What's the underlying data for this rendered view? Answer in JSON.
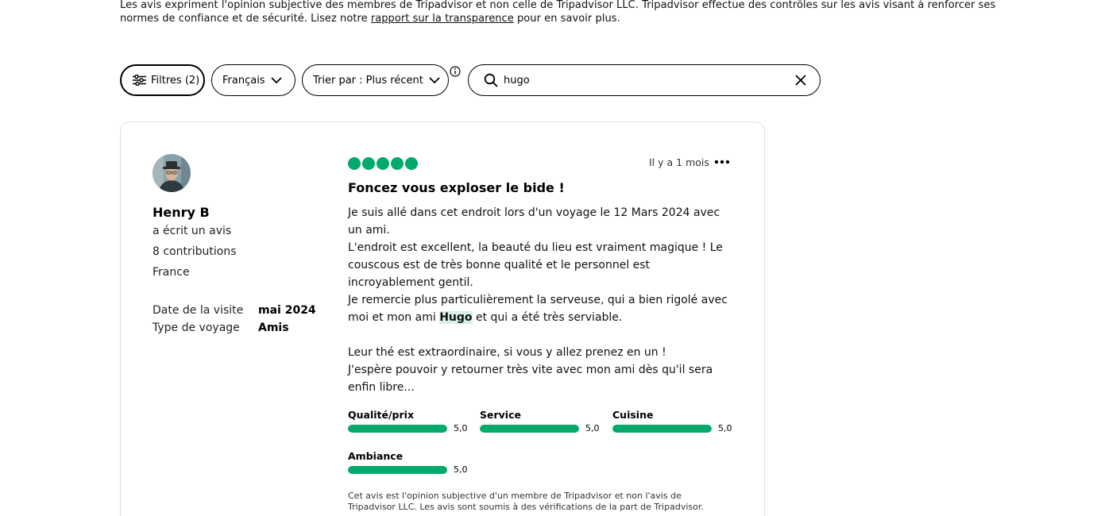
{
  "disclaimer": {
    "text_before": "Les avis expriment l'opinion subjective des membres de Tripadvisor et non celle de Tripadvisor LLC. Tripadvisor effectue des contrôles sur les avis visant à renforcer ses normes de confiance et de sécurité. Lisez notre ",
    "link": "rapport sur la transparence",
    "text_after": " pour en savoir plus."
  },
  "toolbar": {
    "filters_label": "Filtres (2)",
    "language_label": "Français",
    "sort_label": "Trier par : Plus récent"
  },
  "search": {
    "value": "hugo"
  },
  "review": {
    "user": {
      "name": "Henry B",
      "action": "a écrit un avis",
      "contributions": "8 contributions",
      "country": "France"
    },
    "visit": {
      "date_label": "Date de la visite",
      "date_value": "mai 2024",
      "type_label": "Type de voyage",
      "type_value": "Amis"
    },
    "rating": 5,
    "date": "Il y a 1 mois",
    "title": "Foncez vous exploser le bide !",
    "body": {
      "line1": "Je suis allé dans cet endroit lors d'un voyage le 12 Mars 2024 avec un ami.",
      "line2": "L'endroit est excellent, la beauté du lieu est vraiment magique ! Le couscous est de très bonne qualité et le personnel est incroyablement gentil.",
      "line3_before": "Je remercie plus particulièrement la serveuse, qui a bien rigolé avec moi et mon ami ",
      "line3_highlight": "Hugo",
      "line3_after": " et qui a été très serviable.",
      "line4": "Leur thé est extraordinaire, si vous y allez prenez en un !",
      "line5": "J'espère pouvoir y retourner très vite avec mon ami dès qu'il sera enfin libre..."
    },
    "sub_ratings": [
      {
        "label": "Qualité/prix",
        "value": "5,0",
        "score": 5
      },
      {
        "label": "Service",
        "value": "5,0",
        "score": 5
      },
      {
        "label": "Cuisine",
        "value": "5,0",
        "score": 5
      },
      {
        "label": "Ambiance",
        "value": "5,0",
        "score": 5
      }
    ],
    "footer": "Cet avis est l'opinion subjective d'un membre de Tripadvisor et non l'avis de Tripadvisor LLC. Les avis sont soumis à des vérifications de la part de Tripadvisor."
  },
  "colors": {
    "accent": "#00aa6c",
    "highlight": "#d8f1e6"
  }
}
